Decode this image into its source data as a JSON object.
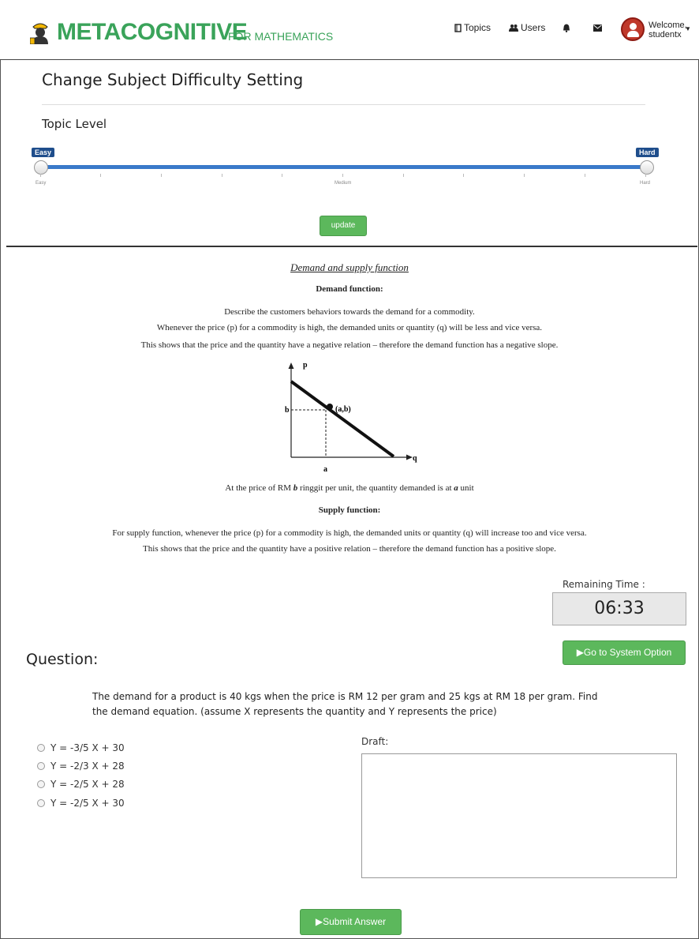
{
  "navbar": {
    "brand": "METACOGNITIVE",
    "brand_sub": "FOR MATHEMATICS",
    "topics_label": "Topics",
    "users_label": "Users",
    "welcome_line1": "Welcome,",
    "welcome_line2": "studentx"
  },
  "difficulty": {
    "title": "Change Subject Difficulty Setting",
    "topic_level_label": "Topic Level",
    "easy_badge": "Easy",
    "hard_badge": "Hard",
    "tick_easy": "Easy",
    "tick_medium": "Medium",
    "tick_hard": "Hard",
    "range_low": 0.0,
    "range_high": 1.0,
    "update_label": "update"
  },
  "content": {
    "heading": "Demand and supply function",
    "demand_heading": "Demand function:",
    "demand_lines": [
      "Describe the customers behaviors towards the demand for a commodity.",
      "Whenever the price (p) for a commodity is high, the demanded units or quantity (q) will be less and vice versa.",
      "This shows that the price and the quantity have a negative relation – therefore the demand function has a negative slope."
    ],
    "graph": {
      "y_axis": "p",
      "x_axis": "q",
      "y_point": "b",
      "x_point": "a",
      "point_label": "(a,b)"
    },
    "price_sentence": {
      "part1": "At the price of RM ",
      "b": "b",
      "part2": " ringgit per unit, the quantity demanded is at ",
      "a": "a",
      "part3": " unit"
    },
    "supply_heading": "Supply function:",
    "supply_lines": [
      "For supply function, whenever the price (p) for a commodity is high, the demanded units or quantity (q) will increase too and vice versa.",
      "This shows that the price and the quantity have a positive relation – therefore the demand function has a positive slope."
    ]
  },
  "timer": {
    "label": "Remaining Time :",
    "value": "06:33"
  },
  "go_button": "Go to System Option",
  "question": {
    "title": "Question:",
    "text": "The demand for a product is 40 kgs when the price is RM 12 per gram and 25 kgs at RM 18 per gram. Find the demand equation. (assume X represents the quantity and Y represents the price)",
    "options": [
      "Y = -3/5 X + 30",
      "Y = -2/3 X + 28",
      "Y = -2/5 X + 28",
      "Y = -2/5 X + 30"
    ]
  },
  "draft_label": "Draft:",
  "submit_button": "Submit Answer"
}
